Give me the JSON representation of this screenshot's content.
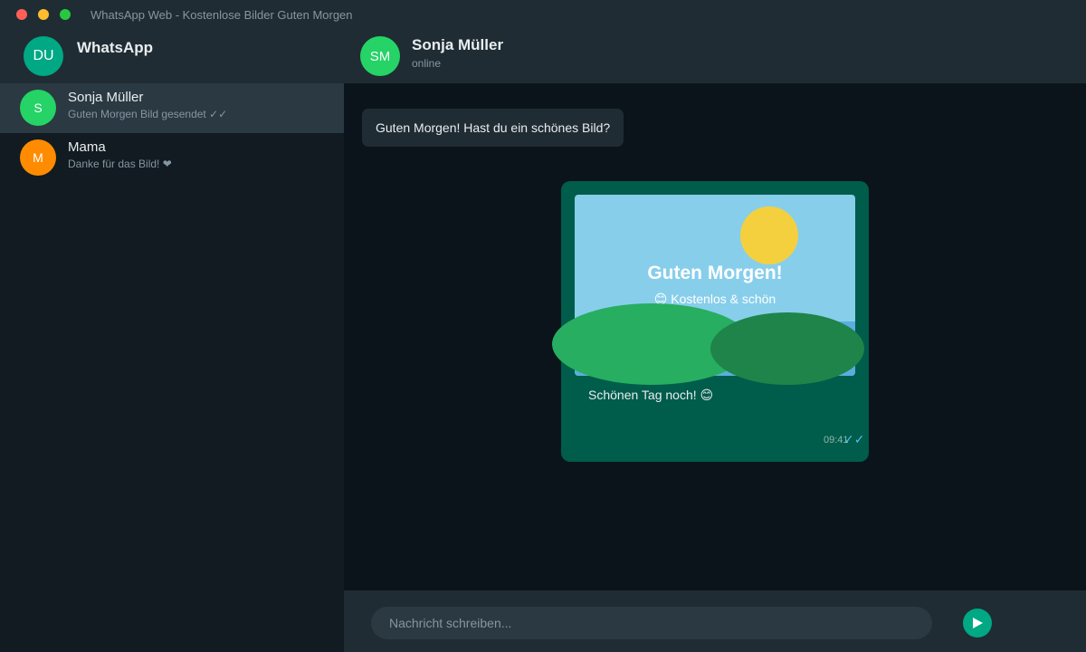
{
  "window": {
    "title": "WhatsApp Web - Kostenlose Bilder Guten Morgen"
  },
  "sidebar": {
    "profile_initials": "DU",
    "app_name": "WhatsApp",
    "chats": [
      {
        "initial": "S",
        "name": "Sonja Müller",
        "preview": "Guten Morgen Bild gesendet ✓✓",
        "avatar_color": "#25d366",
        "active": true
      },
      {
        "initial": "M",
        "name": "Mama",
        "preview": "Danke für das Bild! ❤",
        "avatar_color": "#ff8c00",
        "active": false
      }
    ]
  },
  "chat": {
    "contact_initials": "SM",
    "contact_name": "Sonja Müller",
    "contact_status": "online",
    "incoming_message": "Guten Morgen! Hast du ein schönes Bild?",
    "image": {
      "title": "Guten Morgen!",
      "subtitle": "😊 Kostenlos & schön"
    },
    "outgoing_caption": "Schönen Tag noch! 😊",
    "outgoing_time": "09:41",
    "outgoing_ticks": "✓✓"
  },
  "composer": {
    "placeholder": "Nachricht schreiben..."
  },
  "colors": {
    "accent": "#00a884",
    "outgoing_bubble": "#005c4b",
    "incoming_bubble": "#202c33",
    "read_ticks": "#53bdeb"
  }
}
